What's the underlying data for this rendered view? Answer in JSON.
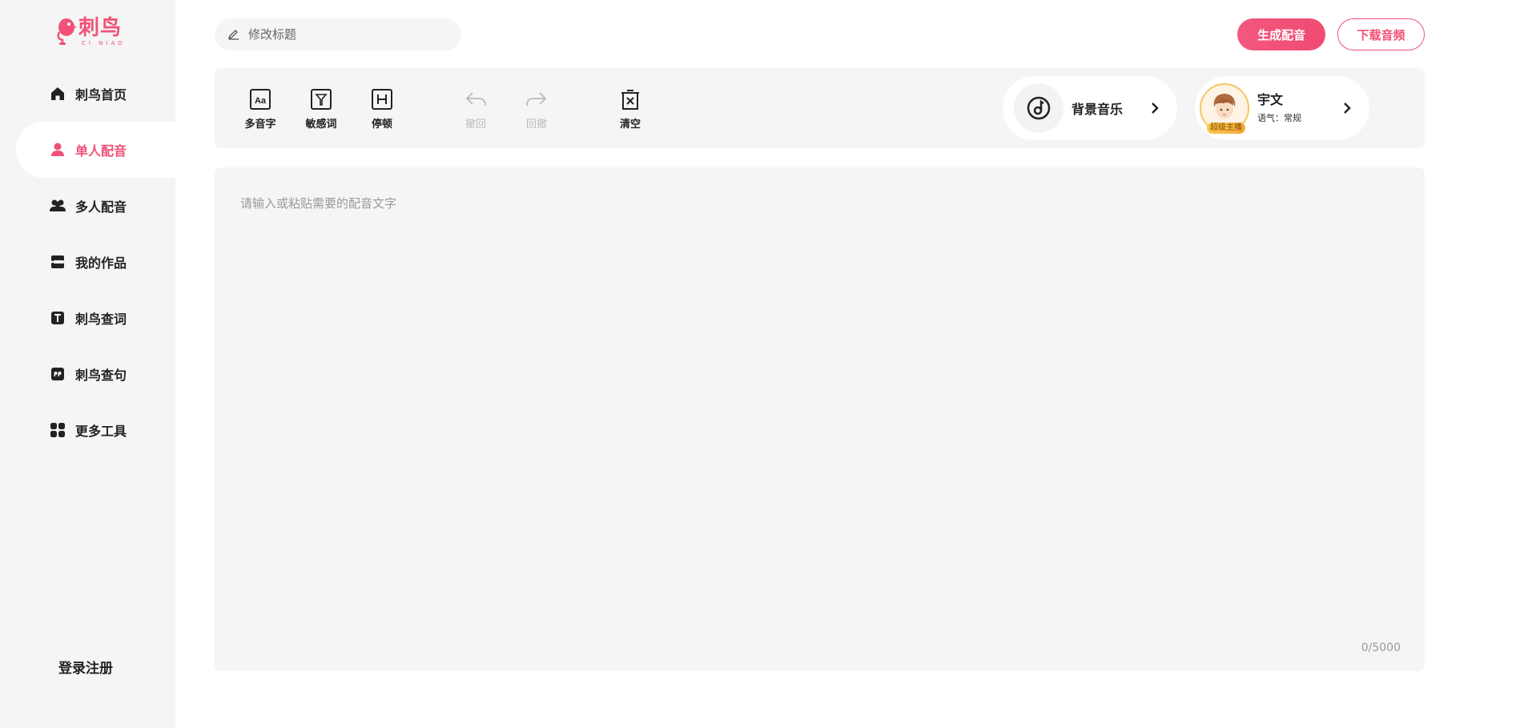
{
  "app": {
    "logo_cn": "刺鸟",
    "logo_pinyin": "CI NIAO",
    "brand_color": "#f25177"
  },
  "sidebar": {
    "items": [
      {
        "label": "刺鸟首页",
        "icon": "home-icon",
        "active": false
      },
      {
        "label": "单人配音",
        "icon": "person-icon",
        "active": true
      },
      {
        "label": "多人配音",
        "icon": "people-icon",
        "active": false
      },
      {
        "label": "我的作品",
        "icon": "works-icon",
        "active": false
      },
      {
        "label": "刺鸟查词",
        "icon": "text-icon",
        "active": false
      },
      {
        "label": "刺鸟查句",
        "icon": "quote-icon",
        "active": false
      },
      {
        "label": "更多工具",
        "icon": "grid-icon",
        "active": false
      }
    ],
    "login": "登录注册"
  },
  "header": {
    "title_placeholder": "修改标题",
    "generate_label": "生成配音",
    "download_label": "下载音频"
  },
  "toolbar": {
    "tools": [
      {
        "label": "多音字",
        "icon": "polyphone-icon",
        "enabled": true
      },
      {
        "label": "敏感词",
        "icon": "filter-icon",
        "enabled": true
      },
      {
        "label": "停顿",
        "icon": "pause-icon",
        "enabled": true
      },
      {
        "label": "撤回",
        "icon": "undo-icon",
        "enabled": false
      },
      {
        "label": "回撤",
        "icon": "redo-icon",
        "enabled": false
      },
      {
        "label": "清空",
        "icon": "clear-icon",
        "enabled": true
      }
    ],
    "bgm_label": "背景音乐",
    "voice": {
      "name": "宇文",
      "tone": "语气：常规",
      "badge": "超级主播"
    }
  },
  "editor": {
    "placeholder": "请输入或粘贴需要的配音文字",
    "value": "",
    "counter": "0/5000"
  }
}
